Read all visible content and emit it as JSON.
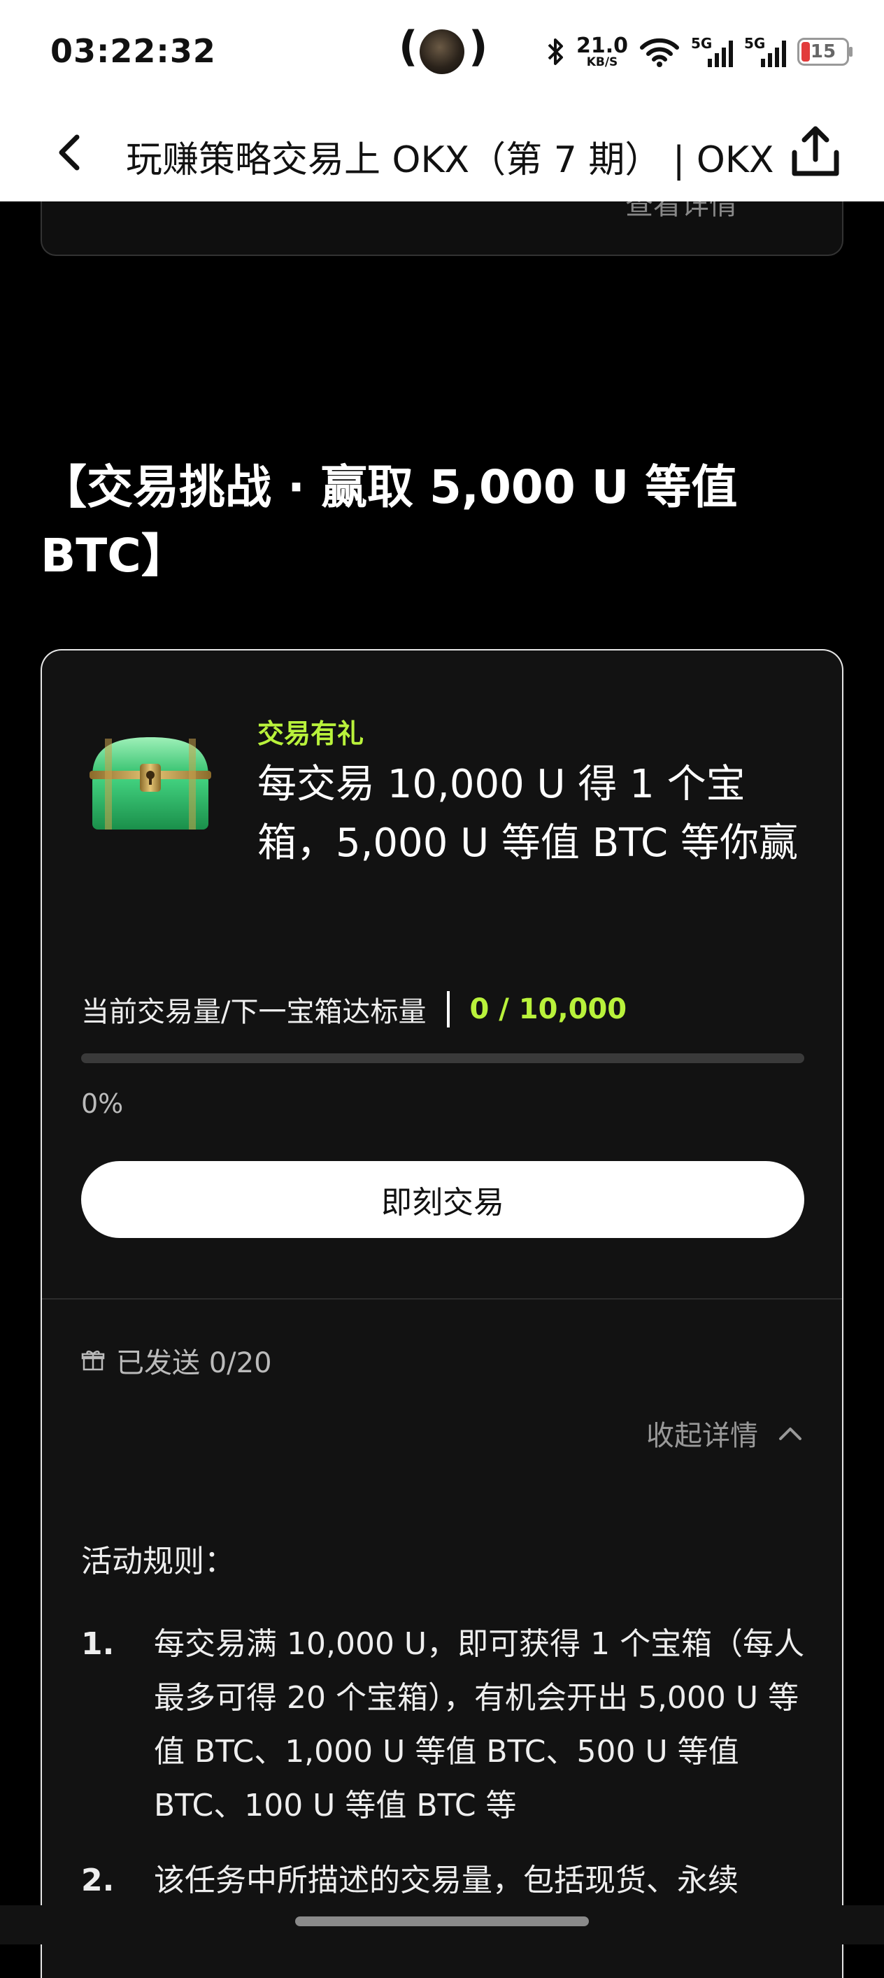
{
  "status_bar": {
    "time": "03:22:32",
    "net_speed_value": "21.0",
    "net_speed_unit": "KB/S",
    "signal1_label": "5G",
    "signal2_label": "5G",
    "battery": "15",
    "battery_color": "#e23b3b"
  },
  "nav": {
    "title": "玩赚策略交易上 OKX（第 7 期） | OKX",
    "back_icon": "chevron-left-icon",
    "share_icon": "share-icon"
  },
  "prev_card": {
    "link_label": "查看详情"
  },
  "section": {
    "title": "【交易挑战 · 赢取 5,000 U 等值 BTC】"
  },
  "task": {
    "tag": "交易有礼",
    "title": "每交易 10,000 U 得 1 个宝箱，5,000 U 等值 BTC 等你赢",
    "metric_label": "当前交易量/下一宝箱达标量",
    "metric_value": "0 / 10,000",
    "progress": 0,
    "progress_label": "0%",
    "button_label": "即刻交易",
    "sent_label": "已发送 0/20",
    "collapse_label": "收起详情",
    "accent_color": "#b9f23b"
  },
  "rules": {
    "title": "活动规则：",
    "items": [
      {
        "num": "1.",
        "text": "每交易满 10,000 U，即可获得 1 个宝箱（每人最多可得 20 个宝箱），有机会开出 5,000 U 等值 BTC、1,000 U 等值 BTC、500 U 等值 BTC、100 U 等值 BTC 等"
      },
      {
        "num": "2.",
        "text": "该任务中所描述的交易量，包括现货、永续"
      }
    ]
  }
}
